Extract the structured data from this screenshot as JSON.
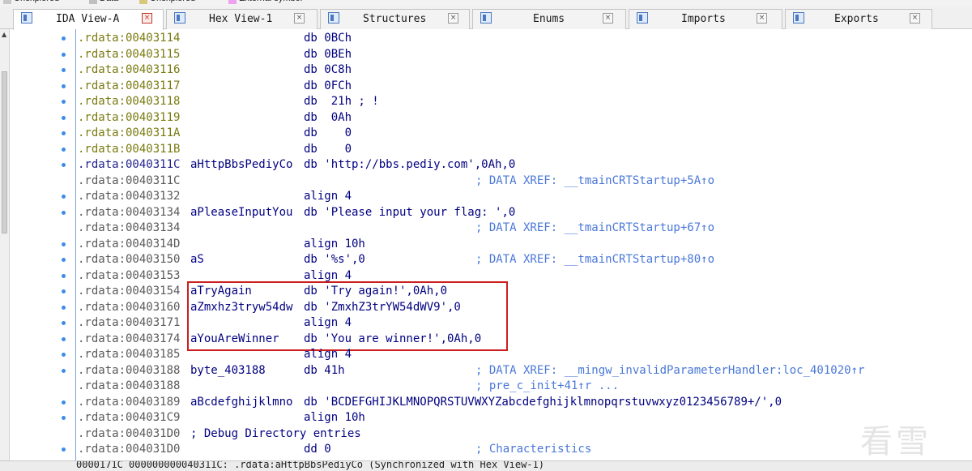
{
  "legend": [
    {
      "label": "Unexplored",
      "color": "#c8c8c8"
    },
    {
      "label": "Data",
      "color": "#c0c0c0"
    },
    {
      "label": "Unexplored",
      "color": "#d8c87a"
    },
    {
      "label": "External symbol",
      "color": "#f0a0f0"
    }
  ],
  "tabs": [
    {
      "label": "IDA View-A",
      "close": "×",
      "active": true
    },
    {
      "label": "Hex View-1",
      "close": "×",
      "active": false
    },
    {
      "label": "Structures",
      "close": "×",
      "active": false
    },
    {
      "label": "Enums",
      "close": "×",
      "active": false
    },
    {
      "label": "Imports",
      "close": "×",
      "active": false
    },
    {
      "label": "Exports",
      "close": "×",
      "active": false
    }
  ],
  "gutter": {
    "scroll_up": "▲"
  },
  "listing": [
    {
      "addr": ".rdata:00403114",
      "label": "",
      "ins": "db 0BCh",
      "comment": "",
      "addr_color": "yellow",
      "dot": true
    },
    {
      "addr": ".rdata:00403115",
      "label": "",
      "ins": "db 0BEh",
      "comment": "",
      "addr_color": "yellow",
      "dot": true
    },
    {
      "addr": ".rdata:00403116",
      "label": "",
      "ins": "db 0C8h",
      "comment": "",
      "addr_color": "yellow",
      "dot": true
    },
    {
      "addr": ".rdata:00403117",
      "label": "",
      "ins": "db 0FCh",
      "comment": "",
      "addr_color": "yellow",
      "dot": true
    },
    {
      "addr": ".rdata:00403118",
      "label": "",
      "ins": "db  21h ; !",
      "comment": "",
      "addr_color": "yellow",
      "dot": true
    },
    {
      "addr": ".rdata:00403119",
      "label": "",
      "ins": "db  0Ah",
      "comment": "",
      "addr_color": "yellow",
      "dot": true
    },
    {
      "addr": ".rdata:0040311A",
      "label": "",
      "ins": "db    0",
      "comment": "",
      "addr_color": "yellow",
      "dot": true
    },
    {
      "addr": ".rdata:0040311B",
      "label": "",
      "ins": "db    0",
      "comment": "",
      "addr_color": "yellow",
      "dot": true
    },
    {
      "addr": ".rdata:0040311C",
      "label": "aHttpBbsPediyCo",
      "ins": "db 'http://bbs.pediy.com',0Ah,0",
      "comment": "",
      "addr_color": "blue",
      "dot": true
    },
    {
      "addr": ".rdata:0040311C",
      "label": "",
      "ins": "",
      "comment": "; DATA XREF: __tmainCRTStartup+5A↑o",
      "addr_color": "gray",
      "dot": false
    },
    {
      "addr": ".rdata:00403132",
      "label": "",
      "ins": "align 4",
      "comment": "",
      "addr_color": "gray",
      "dot": true
    },
    {
      "addr": ".rdata:00403134",
      "label": "aPleaseInputYou",
      "ins": "db 'Please input your flag: ',0",
      "comment": "",
      "addr_color": "gray",
      "dot": true
    },
    {
      "addr": ".rdata:00403134",
      "label": "",
      "ins": "",
      "comment": "; DATA XREF: __tmainCRTStartup+67↑o",
      "addr_color": "gray",
      "dot": false
    },
    {
      "addr": ".rdata:0040314D",
      "label": "",
      "ins": "align 10h",
      "comment": "",
      "addr_color": "gray",
      "dot": true
    },
    {
      "addr": ".rdata:00403150",
      "label": "aS",
      "ins": "db '%s',0",
      "comment": "; DATA XREF: __tmainCRTStartup+80↑o",
      "addr_color": "gray",
      "dot": true
    },
    {
      "addr": ".rdata:00403153",
      "label": "",
      "ins": "align 4",
      "comment": "",
      "addr_color": "gray",
      "dot": true
    },
    {
      "addr": ".rdata:00403154",
      "label": "aTryAgain",
      "ins": "db 'Try again!',0Ah,0",
      "comment": "",
      "addr_color": "gray",
      "dot": true
    },
    {
      "addr": ".rdata:00403160",
      "label": "aZmxhz3tryw54dw",
      "ins": "db 'ZmxhZ3trYW54dWV9',0",
      "comment": "",
      "addr_color": "gray",
      "dot": true
    },
    {
      "addr": ".rdata:00403171",
      "label": "",
      "ins": "align 4",
      "comment": "",
      "addr_color": "gray",
      "dot": true
    },
    {
      "addr": ".rdata:00403174",
      "label": "aYouAreWinner",
      "ins": "db 'You are winner!',0Ah,0",
      "comment": "",
      "addr_color": "gray",
      "dot": true
    },
    {
      "addr": ".rdata:00403185",
      "label": "",
      "ins": "align 4",
      "comment": "",
      "addr_color": "gray",
      "dot": true
    },
    {
      "addr": ".rdata:00403188",
      "label": "byte_403188",
      "ins": "db 41h",
      "comment": "; DATA XREF: __mingw_invalidParameterHandler:loc_401020↑r",
      "addr_color": "gray",
      "dot": true
    },
    {
      "addr": ".rdata:00403188",
      "label": "",
      "ins": "",
      "comment": "; pre_c_init+41↑r ...",
      "addr_color": "gray",
      "dot": false
    },
    {
      "addr": ".rdata:00403189",
      "label": "aBcdefghijklmno",
      "ins": "db 'BCDEFGHIJKLMNOPQRSTUVWXYZabcdefghijklmnopqrstuvwxyz0123456789+/',0",
      "comment": "",
      "addr_color": "gray",
      "dot": true
    },
    {
      "addr": ".rdata:004031C9",
      "label": "",
      "ins": "align 10h",
      "comment": "",
      "addr_color": "gray",
      "dot": true
    },
    {
      "addr": ".rdata:004031D0",
      "label": "; Debug Directory entries",
      "ins": "",
      "comment": "",
      "addr_color": "gray",
      "dot": false
    },
    {
      "addr": ".rdata:004031D0",
      "label": "",
      "ins": "dd 0",
      "comment": "; Characteristics",
      "addr_color": "gray",
      "dot": true
    }
  ],
  "status": {
    "text": "0000171C 000000000040311C: .rdata:aHttpBbsPediyCo (Synchronized with Hex View-1)"
  },
  "watermark": "看雪",
  "colors": {
    "highlight_box": "#cc1e1e",
    "comment": "#4a78d8",
    "code": "#000080"
  }
}
